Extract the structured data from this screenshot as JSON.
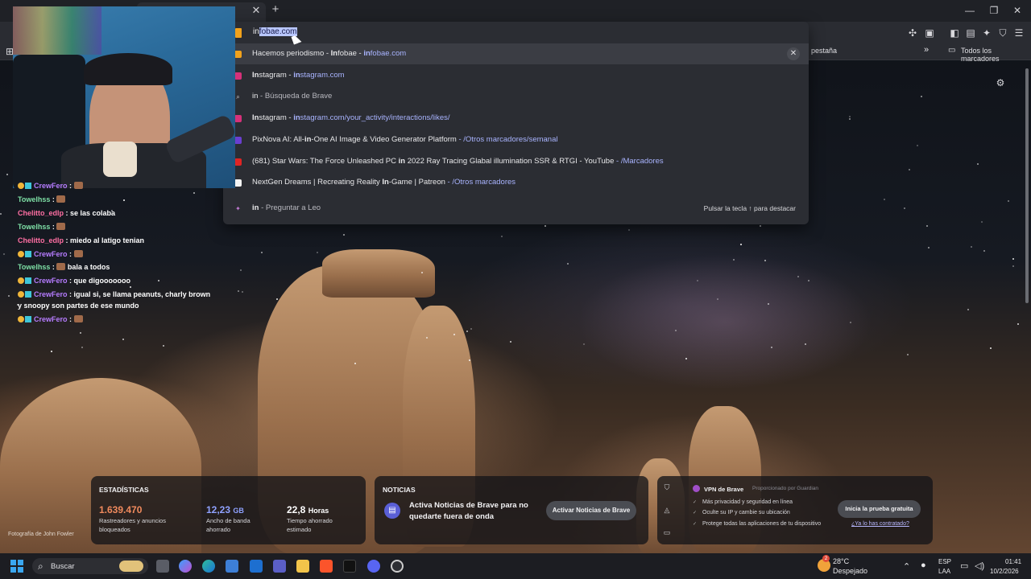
{
  "omnibox": {
    "typed_prefix": "in",
    "autocomplete_suffix": "fobae.com"
  },
  "suggestions": [
    {
      "segments": [
        {
          "t": "Hacemos periodismo - ",
          "s": ""
        },
        {
          "t": "In",
          "s": "b"
        },
        {
          "t": "fobae - ",
          "s": ""
        },
        {
          "t": "in",
          "s": "url b"
        },
        {
          "t": "fobae.com",
          "s": "url"
        }
      ],
      "icon": "infobae-favicon",
      "icon_color": "#f2a21b"
    },
    {
      "segments": [
        {
          "t": "In",
          "s": "b"
        },
        {
          "t": "stagram - ",
          "s": ""
        },
        {
          "t": "in",
          "s": "url b"
        },
        {
          "t": "stagram.com",
          "s": "url"
        }
      ],
      "icon": "instagram-icon",
      "icon_color": "#d6317a"
    },
    {
      "segments": [
        {
          "t": "in",
          "s": ""
        },
        {
          "t": " - Búsqueda de Brave",
          "s": "dim"
        }
      ],
      "icon": "search-icon",
      "icon_color": "transparent"
    },
    {
      "segments": [
        {
          "t": "In",
          "s": "b"
        },
        {
          "t": "stagram - ",
          "s": ""
        },
        {
          "t": "in",
          "s": "url b"
        },
        {
          "t": "stagram.com/your_activity/interactions/likes/",
          "s": "url"
        }
      ],
      "icon": "instagram-icon",
      "icon_color": "#d6317a"
    },
    {
      "segments": [
        {
          "t": "PixNova AI: All-",
          "s": ""
        },
        {
          "t": "in",
          "s": "b"
        },
        {
          "t": "-One AI Image & Video Generator Platform",
          "s": ""
        },
        {
          "t": " - /Otros marcadores/semanal",
          "s": "url"
        }
      ],
      "icon": "pixnova-icon",
      "icon_color": "#6a3fd0"
    },
    {
      "segments": [
        {
          "t": "(681) Star Wars: The Force Unleashed PC ",
          "s": ""
        },
        {
          "t": "in",
          "s": "b"
        },
        {
          "t": " 2022 Ray Tracing Glabal illumination SSR & RTGI - YouTube",
          "s": ""
        },
        {
          "t": " - /Marcadores",
          "s": "url"
        }
      ],
      "icon": "youtube-icon",
      "icon_color": "#e02424"
    },
    {
      "segments": [
        {
          "t": "NextGen Dreams | Recreating Reality ",
          "s": ""
        },
        {
          "t": "In",
          "s": "b"
        },
        {
          "t": "-Game | Patreon",
          "s": ""
        },
        {
          "t": " - /Otros marcadores",
          "s": "url"
        }
      ],
      "icon": "patreon-icon",
      "icon_color": "#f4f4f4"
    }
  ],
  "leo": {
    "segments": [
      {
        "t": "in",
        "s": "b"
      },
      {
        "t": " - Preguntar a Leo",
        "s": "dim"
      }
    ],
    "hint": "Pulsar la tecla ↑ para destacar"
  },
  "bookmarks": {
    "partial_tab_label": "pestaña",
    "all_bookmarks": "Todos los marcadores"
  },
  "chat": [
    {
      "user": "CrewFero",
      "color": "#b67cff",
      "badges": true,
      "msg": "",
      "emote": true
    },
    {
      "user": "Towelhss",
      "color": "#7ee0a6",
      "badges": false,
      "msg": "",
      "emote": true
    },
    {
      "user": "Chelitto_edlp",
      "color": "#ff6fa3",
      "badges": false,
      "msg": "se las colaba",
      "emote": false
    },
    {
      "user": "Towelhss",
      "color": "#7ee0a6",
      "badges": false,
      "msg": "",
      "emote": true
    },
    {
      "user": "Chelitto_edlp",
      "color": "#ff6fa3",
      "badges": false,
      "msg": "miedo al latigo tenian",
      "emote": false
    },
    {
      "user": "CrewFero",
      "color": "#b67cff",
      "badges": true,
      "msg": "",
      "emote": true
    },
    {
      "user": "Towelhss",
      "color": "#7ee0a6",
      "badges": false,
      "msg": "bala a todos",
      "emote": true
    },
    {
      "user": "CrewFero",
      "color": "#b67cff",
      "badges": true,
      "msg": "que digooooooo",
      "emote": false
    },
    {
      "user": "CrewFero",
      "color": "#b67cff",
      "badges": true,
      "msg": "igual si, se llama peanuts, charly brown",
      "emote": false
    },
    {
      "user": "",
      "color": "#ffffff",
      "badges": false,
      "msg": "y snoopy son partes de ese mundo",
      "emote": false
    },
    {
      "user": "CrewFero",
      "color": "#b67cff",
      "badges": true,
      "msg": "",
      "emote": true
    }
  ],
  "stats": {
    "title": "ESTADÍSTICAS",
    "trackers_value": "1.639.470",
    "trackers_label": "Rastreadores y anuncios bloqueados",
    "bandwidth_value": "12,23",
    "bandwidth_unit": "GB",
    "bandwidth_label": "Ancho de banda ahorrado",
    "time_value": "22,8",
    "time_unit": "Horas",
    "time_label": "Tiempo ahorrado estimado"
  },
  "news": {
    "title": "NOTICIAS",
    "text": "Activa Noticias de Brave para no quedarte fuera de onda",
    "button": "Activar Noticias de Brave"
  },
  "vpn": {
    "title": "VPN de Brave",
    "provided_by": "Proporcionado por",
    "provider": "Guardian",
    "items": [
      "Más privacidad y seguridad en línea",
      "Oculte su IP y cambie su ubicación",
      "Protege todas las aplicaciones de tu dispositivo"
    ],
    "button": "Inicia la prueba gratuita",
    "link": "¿Ya lo has contratado?"
  },
  "photo_credit": "Fotografía de John Fowler",
  "taskbar": {
    "search": "Buscar",
    "weather_temp": "28°C",
    "weather_desc": "Despejado",
    "weather_badge": "2",
    "lang_1": "ESP",
    "lang_2": "LAA",
    "time": "01:41",
    "date": "10/2/2026"
  },
  "colors": {
    "accent_url": "#a9b4ff",
    "stat_trackers": "#f08a5d",
    "stat_bandwidth": "#8fa2ff",
    "stat_time": "#ffffff"
  }
}
